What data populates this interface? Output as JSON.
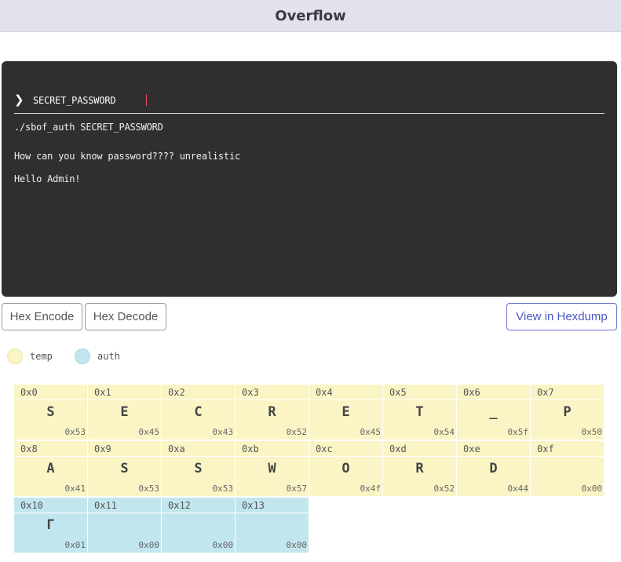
{
  "app": {
    "title": "Overflow"
  },
  "terminal": {
    "prompt_icon": "❯",
    "input_value": "SECRET_PASSWORD",
    "output_lines": [
      "./sbof_auth SECRET_PASSWORD",
      "How can you know password???? unrealistic",
      "Hello Admin!"
    ]
  },
  "toolbar": {
    "hex_encode_label": "Hex Encode",
    "hex_decode_label": "Hex Decode",
    "view_hexdump_label": "View in Hexdump"
  },
  "legend": [
    {
      "label": "temp",
      "color": "#fbf5c6"
    },
    {
      "label": "auth",
      "color": "#c2e6ee"
    }
  ],
  "memory": [
    {
      "addr": "0x0",
      "char": "S",
      "hex": "0x53",
      "region": "temp"
    },
    {
      "addr": "0x1",
      "char": "E",
      "hex": "0x45",
      "region": "temp"
    },
    {
      "addr": "0x2",
      "char": "C",
      "hex": "0x43",
      "region": "temp"
    },
    {
      "addr": "0x3",
      "char": "R",
      "hex": "0x52",
      "region": "temp"
    },
    {
      "addr": "0x4",
      "char": "E",
      "hex": "0x45",
      "region": "temp"
    },
    {
      "addr": "0x5",
      "char": "T",
      "hex": "0x54",
      "region": "temp"
    },
    {
      "addr": "0x6",
      "char": "_",
      "hex": "0x5f",
      "region": "temp"
    },
    {
      "addr": "0x7",
      "char": "P",
      "hex": "0x50",
      "region": "temp"
    },
    {
      "addr": "0x8",
      "char": "A",
      "hex": "0x41",
      "region": "temp"
    },
    {
      "addr": "0x9",
      "char": "S",
      "hex": "0x53",
      "region": "temp"
    },
    {
      "addr": "0xa",
      "char": "S",
      "hex": "0x53",
      "region": "temp"
    },
    {
      "addr": "0xb",
      "char": "W",
      "hex": "0x57",
      "region": "temp"
    },
    {
      "addr": "0xc",
      "char": "O",
      "hex": "0x4f",
      "region": "temp"
    },
    {
      "addr": "0xd",
      "char": "R",
      "hex": "0x52",
      "region": "temp"
    },
    {
      "addr": "0xe",
      "char": "D",
      "hex": "0x44",
      "region": "temp"
    },
    {
      "addr": "0xf",
      "char": "",
      "hex": "0x00",
      "region": "temp"
    },
    {
      "addr": "0x10",
      "char": "Γ",
      "hex": "0x01",
      "region": "auth"
    },
    {
      "addr": "0x11",
      "char": "",
      "hex": "0x00",
      "region": "auth"
    },
    {
      "addr": "0x12",
      "char": "",
      "hex": "0x00",
      "region": "auth"
    },
    {
      "addr": "0x13",
      "char": "",
      "hex": "0x00",
      "region": "auth"
    }
  ]
}
